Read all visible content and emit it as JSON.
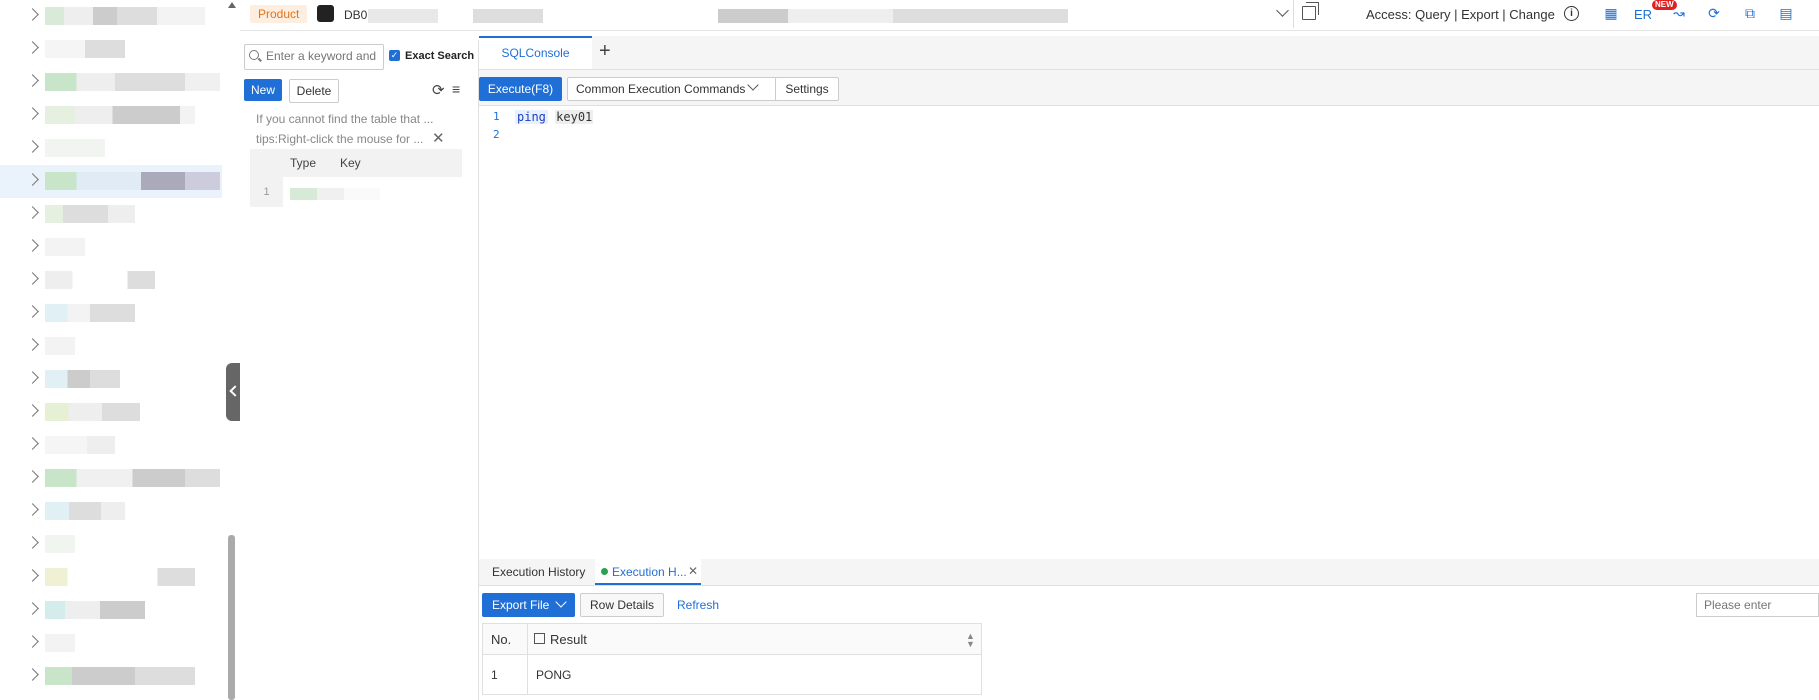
{
  "topbar": {
    "product_badge": "Product",
    "db_name": "DB0",
    "access_text": "Access:  Query | Export | Change",
    "er_label": "ER",
    "new_badge": "NEW"
  },
  "table_panel": {
    "search_placeholder": "Enter a keyword and",
    "exact_search_label": "Exact Search",
    "new_label": "New",
    "delete_label": "Delete",
    "tip_missing": "If you cannot find the table that ...",
    "tip_rightclick": "tips:Right-click the mouse for ...",
    "columns": [
      "Type",
      "Key"
    ],
    "row_number": "1"
  },
  "editor": {
    "tab_label": "SQLConsole",
    "execute_label": "Execute(F8)",
    "commands_label": "Common Execution Commands",
    "settings_label": "Settings",
    "line_numbers": [
      "1",
      "2"
    ],
    "code_keyword": "ping",
    "code_arg": "key01"
  },
  "results": {
    "tab_history": "Execution History",
    "tab_active": "Execution H...",
    "export_label": "Export File",
    "row_details_label": "Row Details",
    "refresh_label": "Refresh",
    "filter_placeholder": "Please enter",
    "columns": [
      "No.",
      "Result"
    ],
    "rows": [
      {
        "no": "1",
        "result": "PONG"
      }
    ]
  },
  "colors": {
    "accent": "#1f6fd6",
    "product_badge_bg": "#fdeee0",
    "product_badge_text": "#e37318",
    "status_ok": "#2aa050"
  }
}
